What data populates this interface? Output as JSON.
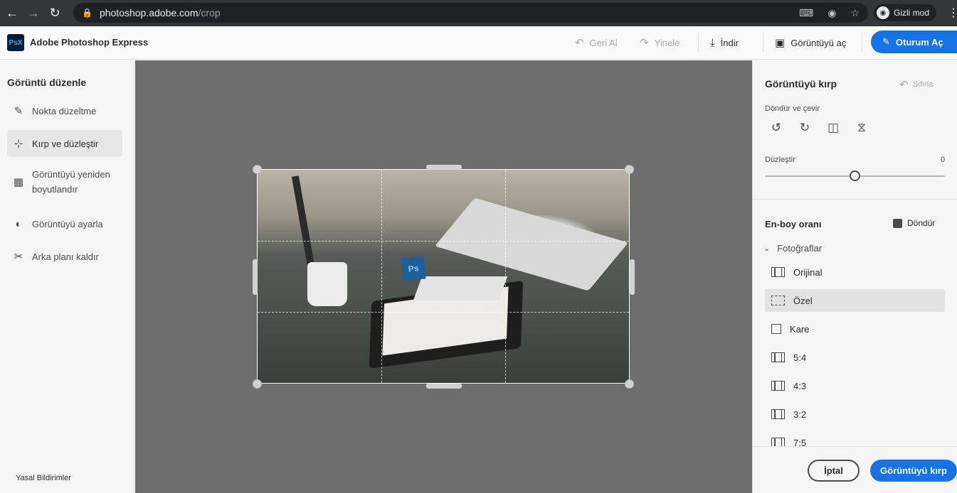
{
  "browser": {
    "url_host": "photoshop.adobe.com",
    "url_path": "/crop",
    "incognito_label": "Gizli mod",
    "icons": [
      "back-icon",
      "forward-icon",
      "reload-icon",
      "lock-icon",
      "translate-icon",
      "eye-off-icon",
      "star-icon",
      "incognito-icon",
      "kebab-menu-icon"
    ]
  },
  "header": {
    "logo_text": "PsX",
    "app_title": "Adobe Photoshop Express",
    "undo_label": "Geri Al",
    "redo_label": "Yinele",
    "download_label": "İndir",
    "open_image_label": "Görüntüyü aç",
    "signin_label": "Oturum Aç"
  },
  "sidebar": {
    "title": "Görüntü düzenle",
    "items": [
      {
        "label": "Nokta düzeltme",
        "icon": "bandage-icon",
        "active": false
      },
      {
        "label": "Kırp ve düzleştir",
        "icon": "crop-icon",
        "active": true
      },
      {
        "label": "Görüntüyü yeniden boyutlandır",
        "icon": "resize-icon",
        "active": false
      },
      {
        "label": "Görüntüyü ayarla",
        "icon": "adjust-icon",
        "active": false
      },
      {
        "label": "Arka planı kaldır",
        "icon": "scissors-icon",
        "active": false
      }
    ],
    "legal_label": "Yasal Bildirimler"
  },
  "canvas": {
    "photo_badge_text": "Ps"
  },
  "panel": {
    "title": "Görüntüyü kırp",
    "reset_label": "Sıfırla",
    "rotate_flip_label": "Döndür ve çevir",
    "rotate_icons": [
      "rotate-left-icon",
      "rotate-right-icon",
      "flip-horizontal-icon",
      "flip-vertical-icon"
    ],
    "straighten_label": "Düzleştir",
    "straighten_value": "0",
    "straighten_fraction": 0.5,
    "aspect_title": "En-boy oranı",
    "aspect_rotate_label": "Döndür",
    "group_label": "Fotoğraflar",
    "ratios": [
      {
        "label": "Orijinal",
        "active": false
      },
      {
        "label": "Özel",
        "active": true
      },
      {
        "label": "Kare",
        "active": false
      },
      {
        "label": "5:4",
        "active": false
      },
      {
        "label": "4:3",
        "active": false
      },
      {
        "label": "3:2",
        "active": false
      },
      {
        "label": "7:5",
        "active": false
      }
    ],
    "cancel_label": "İptal",
    "crop_label": "Görüntüyü kırp"
  },
  "colors": {
    "accent": "#1473e6",
    "canvas_bg": "#6e6e6e",
    "chrome_bg": "#35363a"
  }
}
